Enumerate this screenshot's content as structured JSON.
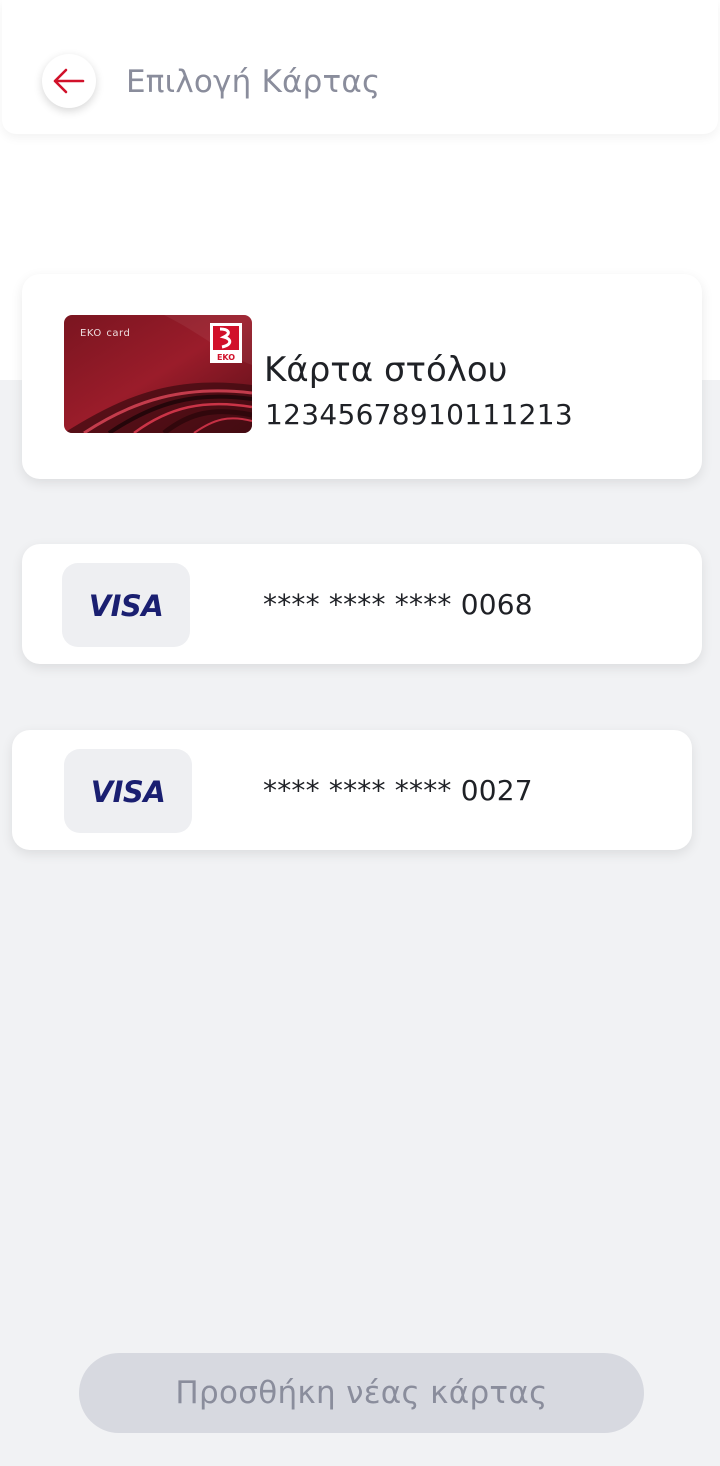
{
  "header": {
    "title": "Επιλογή Κάρτας",
    "back_icon": "arrow-left-icon",
    "accent_color": "#d1112a"
  },
  "cards": {
    "fleet": {
      "brand": "EKO",
      "brand_suffix": "card",
      "logo_text": "EKO",
      "name": "Κάρτα στόλου",
      "number": "12345678910111213"
    },
    "visa_1": {
      "logo": "VISA",
      "masked_number": "**** **** **** 0068"
    },
    "visa_2": {
      "logo": "VISA",
      "masked_number": "**** **** **** 0027"
    }
  },
  "footer": {
    "add_card_label": "Προσθήκη νέας κάρτας"
  },
  "colors": {
    "background": "#f1f2f4",
    "visa_blue": "#1a1f71",
    "disabled_button": "#d7d9e0",
    "muted_text": "#8a8d9c"
  }
}
